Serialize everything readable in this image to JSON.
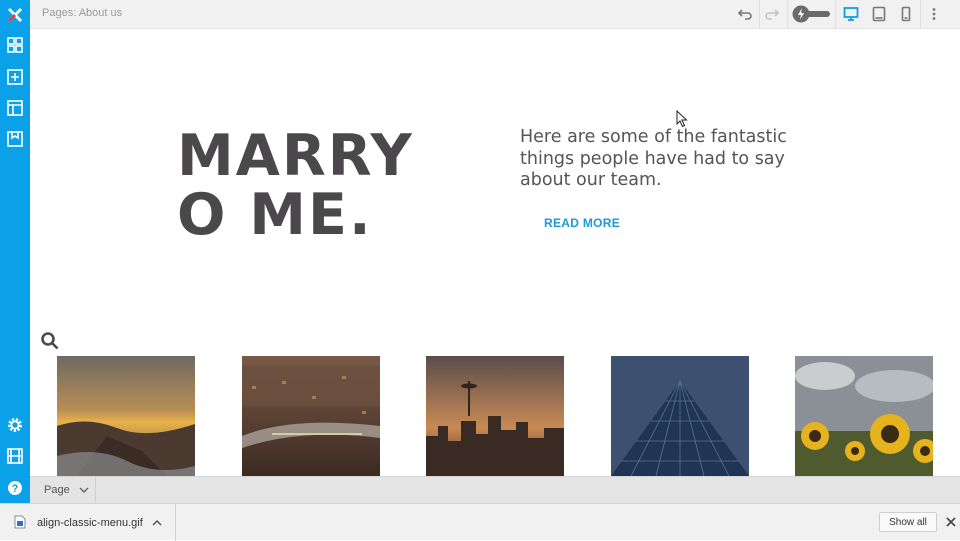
{
  "topbar": {
    "breadcrumb": "Pages: About us",
    "icons": [
      "undo-icon",
      "redo-icon",
      "lightning-toggle",
      "desktop-icon",
      "tablet-icon",
      "mobile-icon",
      "more-vertical-icon"
    ]
  },
  "sidebar": {
    "top_icons": [
      "logo-x-icon",
      "widgets-icon",
      "add-icon",
      "layout-icon",
      "save-icon"
    ],
    "bottom_icons": [
      "gear-icon",
      "media-icon",
      "help-icon"
    ]
  },
  "hero": {
    "title": "MARRY O ME.",
    "text": "Here are some of the fantastic things people have had to say about our team.",
    "link_label": "READ MORE"
  },
  "gallery": {
    "images": [
      "sunset-coast-image",
      "city-river-image",
      "skyline-tower-image",
      "glass-building-image",
      "sunflowers-image"
    ]
  },
  "pagebar": {
    "select_label": "Page"
  },
  "downloads": {
    "file_name": "align-classic-menu.gif",
    "show_all_label": "Show all"
  },
  "colors": {
    "accent": "#0aa1e8",
    "link": "#1a9ad6",
    "title": "#4a484b",
    "text": "#555457"
  }
}
